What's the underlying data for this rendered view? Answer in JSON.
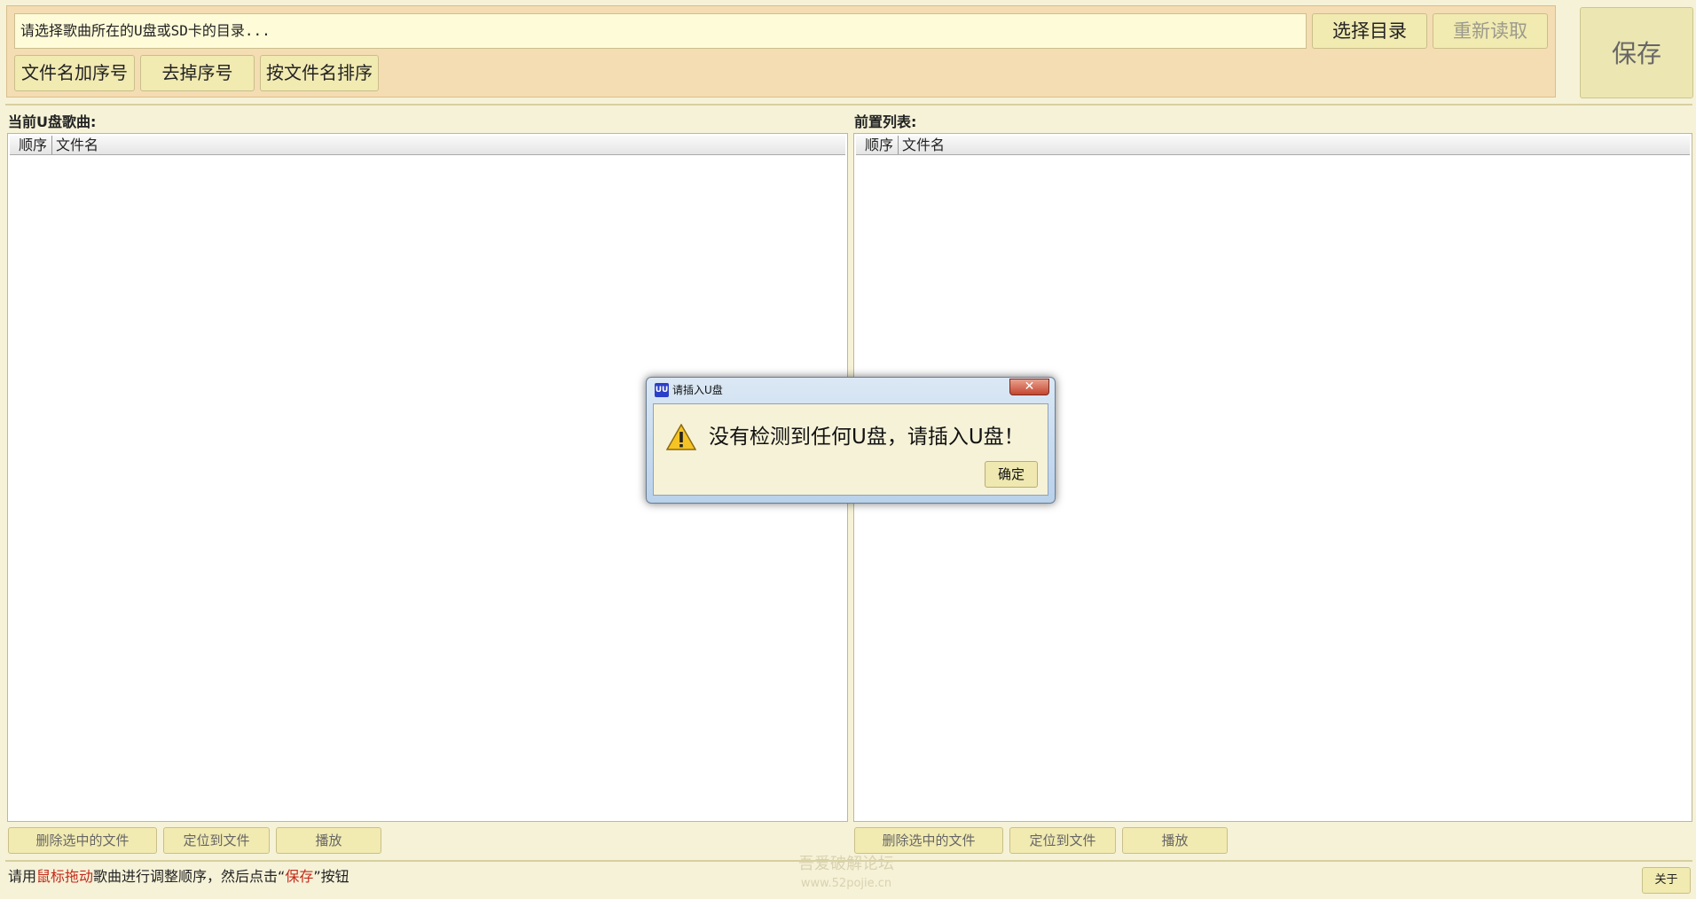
{
  "top": {
    "path_value": "请选择歌曲所在的U盘或SD卡的目录...",
    "choose_dir_label": "选择目录",
    "reread_label": "重新读取",
    "add_index_label": "文件名加序号",
    "remove_index_label": "去掉序号",
    "sort_by_name_label": "按文件名排序",
    "save_label": "保存"
  },
  "left_panel": {
    "title": "当前U盘歌曲:",
    "columns": [
      "顺序",
      "文件名"
    ],
    "rows": [],
    "buttons": {
      "delete": "删除选中的文件",
      "locate": "定位到文件",
      "play": "播放"
    }
  },
  "right_panel": {
    "title": "前置列表:",
    "columns": [
      "顺序",
      "文件名"
    ],
    "rows": [],
    "buttons": {
      "delete": "删除选中的文件",
      "locate": "定位到文件",
      "play": "播放"
    }
  },
  "status": {
    "part1": "请用",
    "highlight1": "鼠标拖动",
    "part2": "歌曲进行调整顺序，然后点击“",
    "highlight2": "保存",
    "part3": "”按钮",
    "about_label": "关于"
  },
  "dialog": {
    "title": "请插入U盘",
    "app_icon_text": "UU",
    "message": "没有检测到任何U盘，请插入U盘！",
    "ok_label": "确定",
    "close_glyph": "✕"
  },
  "watermark": {
    "line1": "吾爱破解论坛",
    "line2": "www.52pojie.cn"
  },
  "colors": {
    "background": "#f6f2d8",
    "top_panel": "#f4dcb3",
    "button": "#f1eab1",
    "highlight_text": "#c52a1b"
  }
}
